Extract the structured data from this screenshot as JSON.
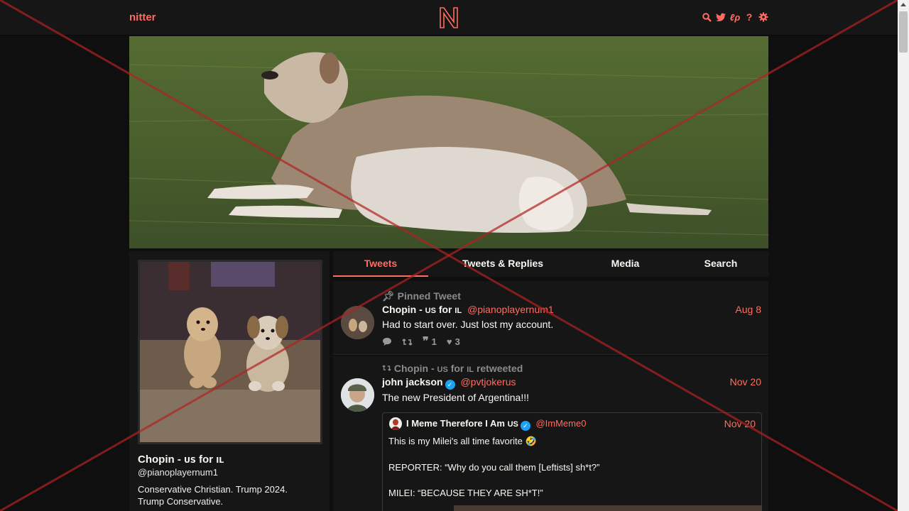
{
  "nav": {
    "logo": "nitter",
    "icons": [
      "search-icon",
      "twitter-bird-icon",
      "instance-icon",
      "help-icon",
      "gear-icon"
    ]
  },
  "profile": {
    "name": "Chopin - ",
    "name_flag": "US",
    "name_for": " for ",
    "name_flag2": "IL",
    "handle": "@pianoplayernum1",
    "bio": "Conservative Christian. Trump 2024. Trump Conservative."
  },
  "tabs": [
    {
      "label": "Tweets",
      "active": true
    },
    {
      "label": "Tweets & Replies",
      "active": false
    },
    {
      "label": "Media",
      "active": false
    },
    {
      "label": "Search",
      "active": false
    }
  ],
  "tweets": [
    {
      "header": "Pinned Tweet",
      "name": "Chopin - US for IL",
      "handle": "@pianoplayernum1",
      "date": "Aug 8",
      "body": "Had to start over. Just lost my account.",
      "stats": {
        "retweets": "",
        "quotes": "1",
        "likes": "3"
      }
    },
    {
      "header": "Chopin - US for IL retweeted",
      "name": "john jackson",
      "handle": "@pvtjokerus",
      "date": "Nov 20",
      "body": "The new President of Argentina!!!",
      "quote": {
        "name": "I Meme Therefore I Am US",
        "handle": "@ImMeme0",
        "date": "Nov 20",
        "line1": "This is my Milei's all time favorite 🤣",
        "line2": "REPORTER: “Why do you call them [Leftists] sh*t?”",
        "line3": "MILEI: “BECAUSE THEY ARE SH*T!”"
      }
    }
  ],
  "colors": {
    "accent": "#ff6c60",
    "background": "#0f0f0f",
    "panel": "#161616",
    "overlay_cross": "#b22222"
  }
}
